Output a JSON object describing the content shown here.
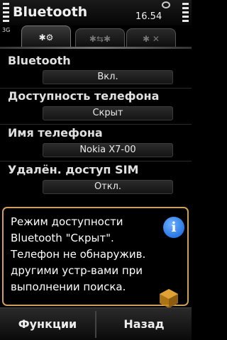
{
  "status_bar": {
    "network": "3G",
    "title": "Bluetooth",
    "time": "16.54"
  },
  "tabs": [
    {
      "label": "✱⚙",
      "icon": "bluetooth-settings-icon"
    },
    {
      "label": "✱⇆✱",
      "icon": "paired-devices-icon"
    },
    {
      "label": "✱ ✕",
      "icon": "blocked-devices-icon"
    }
  ],
  "settings": [
    {
      "label": "Bluetooth",
      "value": "Вкл."
    },
    {
      "label": "Доступность телефона",
      "value": "Скрыт"
    },
    {
      "label": "Имя телефона",
      "value": "Nokia X7-00"
    },
    {
      "label": "Удалён. доступ SIM",
      "value": "Откл."
    }
  ],
  "dialog": {
    "message": "Режим доступности Bluetooth \"Скрыт\". Телефон не обнаружив. другими устр-вами при выполнении поиска.",
    "icon": "info-icon"
  },
  "softkeys": {
    "left": "Функции",
    "right": "Назад"
  },
  "colors": {
    "dialog_border": "#cfa05a",
    "info_icon": "#0a5fd8"
  }
}
